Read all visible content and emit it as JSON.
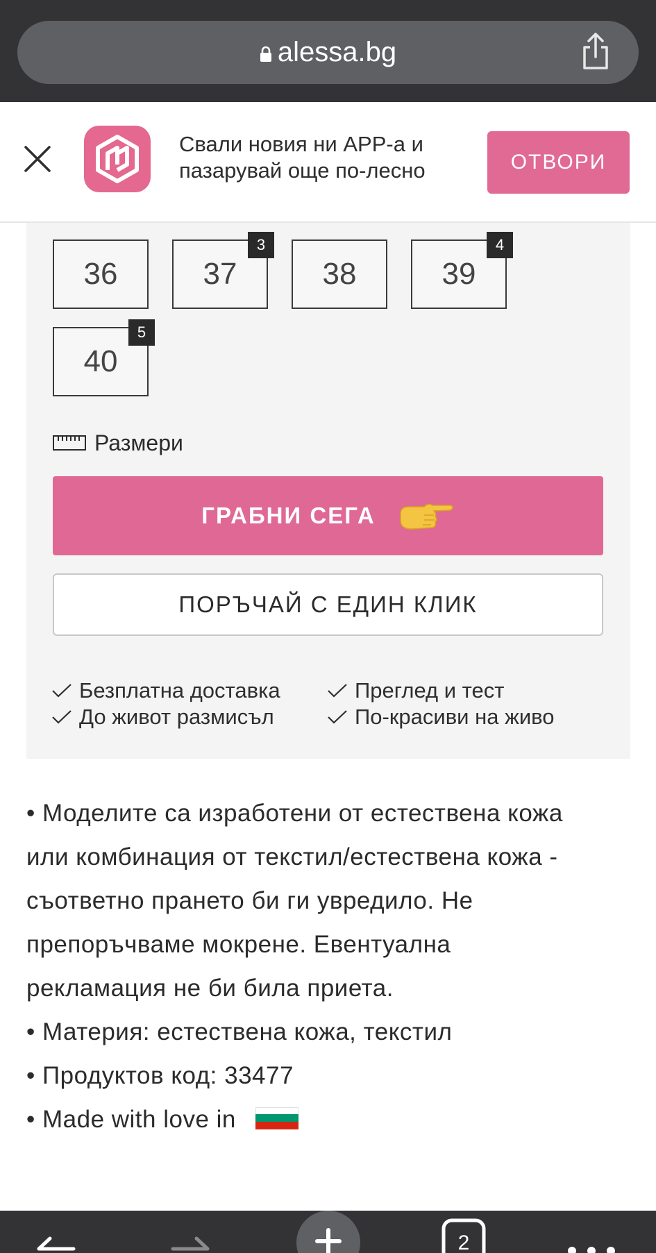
{
  "browser": {
    "url": "alessa.bg",
    "icons": {
      "lock": "lock-icon",
      "share": "share-icon"
    }
  },
  "app_banner": {
    "text_line1": "Свали новия ни APP-а и",
    "text_line2": "пазарувай още по-лесно",
    "open_label": "ОТВОРИ",
    "logo_color": "#e4688f"
  },
  "sizes": [
    {
      "label": "36",
      "stock": ""
    },
    {
      "label": "37",
      "stock": "3"
    },
    {
      "label": "38",
      "stock": ""
    },
    {
      "label": "39",
      "stock": "4"
    },
    {
      "label": "40",
      "stock": "5"
    }
  ],
  "size_guide_label": "Размери",
  "grab_label": "ГРАБНИ СЕГА",
  "one_click_label": "ПОРЪЧАЙ С ЕДИН КЛИК",
  "benefits": {
    "free_delivery": "Безплатна доставка",
    "lifetime_return": "До живот размисъл",
    "inspect_test": "Преглед и тест",
    "prettier_live": "По-красиви на живо"
  },
  "description": {
    "line1": "• Моделите са изработени от естествена кожа",
    "line2": "или комбинация от текстил/естествена кожа -",
    "line3": "съответно прането би ги увредило. Не",
    "line4": "препоръчваме мокрене. Евентуална",
    "line5": "рекламация не би била приета.",
    "material": "• Материя: естествена кожа, текстил",
    "code": "• Продуктов код: 33477",
    "made": "• Made with love in"
  },
  "colors": {
    "accent_pink": "#df6994",
    "browser_bar": "#333335",
    "panel_bg": "#f4f4f4"
  }
}
